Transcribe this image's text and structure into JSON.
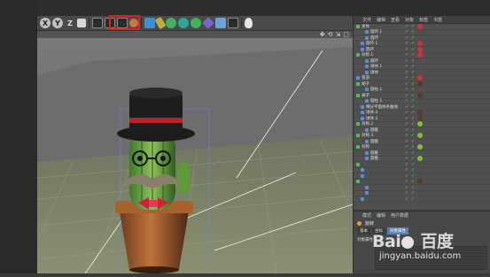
{
  "toolbar": {
    "buttons": [
      {
        "name": "x-axis-button",
        "glyph": "X"
      },
      {
        "name": "y-axis-button",
        "glyph": "Y"
      },
      {
        "name": "z-axis-button",
        "glyph": "Z"
      }
    ]
  },
  "object_manager": {
    "menu": [
      "文件",
      "编辑",
      "查看",
      "对象",
      "标签",
      "书签"
    ],
    "rows": [
      {
        "label": "身体",
        "indent": 0,
        "icon": "green",
        "tags": [
          "check",
          "check",
          "mat-red"
        ]
      },
      {
        "label": "圆环.1",
        "indent": 2,
        "icon": "blue",
        "tags": [
          "check",
          "check"
        ]
      },
      {
        "label": "圆环",
        "indent": 2,
        "icon": "blue",
        "tags": [
          "check",
          "check"
        ]
      },
      {
        "label": "圆环.1",
        "indent": 1,
        "icon": "blue",
        "tags": [
          "check",
          "check",
          "mat-red"
        ]
      },
      {
        "label": "圆环",
        "indent": 1,
        "icon": "blue",
        "tags": [
          "check",
          "check",
          "mat-red"
        ]
      },
      {
        "label": "对称.1",
        "indent": 0,
        "icon": "green",
        "tags": [
          "check",
          "check",
          "mat-red"
        ]
      },
      {
        "label": "圆环",
        "indent": 2,
        "icon": "blue",
        "tags": [
          "check",
          "check"
        ]
      },
      {
        "label": "球体.1",
        "indent": 2,
        "icon": "blue",
        "tags": [
          "check",
          "check"
        ]
      },
      {
        "label": "球体",
        "indent": 2,
        "icon": "blue",
        "tags": [
          "check",
          "check"
        ]
      },
      {
        "label": "管道",
        "indent": 0,
        "icon": "blue",
        "tags": [
          "check",
          "check",
          "mat-red"
        ]
      },
      {
        "label": "胡子",
        "indent": 0,
        "icon": "green",
        "tags": [
          "check",
          "check",
          "mat-dark"
        ]
      },
      {
        "label": "圆柱.1",
        "indent": 2,
        "icon": "blue",
        "tags": [
          "check",
          "check"
        ]
      },
      {
        "label": "胡子",
        "indent": 0,
        "icon": "green",
        "tags": [
          "check",
          "check",
          "mat-dark"
        ]
      },
      {
        "label": "圆柱.1",
        "indent": 2,
        "icon": "blue",
        "tags": [
          "check",
          "check"
        ]
      },
      {
        "label": "细分平面样条曲线",
        "indent": 1,
        "icon": "blue",
        "tags": [
          "check",
          "check"
        ]
      },
      {
        "label": "球体.4",
        "indent": 1,
        "icon": "blue",
        "tags": [
          "check",
          "check",
          "mat-dark"
        ]
      },
      {
        "label": "球体.3",
        "indent": 1,
        "icon": "blue",
        "tags": [
          "check",
          "check",
          "mat-dark"
        ]
      },
      {
        "label": "对称.2",
        "indent": 0,
        "icon": "green",
        "tags": [
          "check",
          "check",
          "mat-green"
        ]
      },
      {
        "label": "圆锥",
        "indent": 2,
        "icon": "blue",
        "tags": [
          "check",
          "check"
        ]
      },
      {
        "label": "对称.3",
        "indent": 0,
        "icon": "green",
        "tags": [
          "check",
          "check",
          "mat-green"
        ]
      },
      {
        "label": "圆锥",
        "indent": 2,
        "icon": "blue",
        "tags": [
          "check",
          "check"
        ]
      },
      {
        "label": "对称",
        "indent": 0,
        "icon": "green",
        "tags": [
          "check",
          "check",
          "mat-green"
        ]
      },
      {
        "label": "圆锥",
        "indent": 2,
        "icon": "blue",
        "tags": [
          "check",
          "check"
        ]
      },
      {
        "label": "圆锥",
        "indent": 2,
        "icon": "blue",
        "tags": [
          "check",
          "check",
          "mat-green"
        ]
      },
      {
        "label": "",
        "indent": 0,
        "icon": "green",
        "tags": [
          "check",
          "check"
        ]
      },
      {
        "label": "",
        "indent": 1,
        "icon": "blue",
        "tags": [
          "check",
          "check"
        ]
      },
      {
        "label": "",
        "indent": 1,
        "icon": "blue",
        "tags": [
          "check",
          "check"
        ]
      },
      {
        "label": "",
        "indent": 0,
        "icon": "green",
        "tags": [
          "check",
          "check",
          "mat-dark"
        ]
      },
      {
        "label": "",
        "indent": 2,
        "icon": "blue",
        "tags": [
          "check",
          "check"
        ]
      },
      {
        "label": "",
        "indent": 2,
        "icon": "blue",
        "tags": [
          "check",
          "check"
        ]
      },
      {
        "label": "",
        "indent": 1,
        "icon": "blue",
        "tags": [
          "check",
          "check"
        ]
      }
    ]
  },
  "attributes": {
    "menu": [
      "模式",
      "编辑",
      "用户数据"
    ],
    "title": "旋转",
    "tabs": [
      "基本",
      "坐标",
      "对象属性"
    ],
    "active_tab": 2,
    "section": "对象属性"
  },
  "watermark": {
    "brand": "Bai  百度",
    "paw_after": 3,
    "url": "jingyan.baidu.com"
  },
  "colors": {
    "highlight": "#e02020",
    "check": "#6fd06f",
    "mat_red": "#d42f3a",
    "mat_dark": "#5a3a2a",
    "mat_green": "#7bc043",
    "icon_green": "#4fbf5a",
    "icon_blue": "#5a8fd6"
  }
}
